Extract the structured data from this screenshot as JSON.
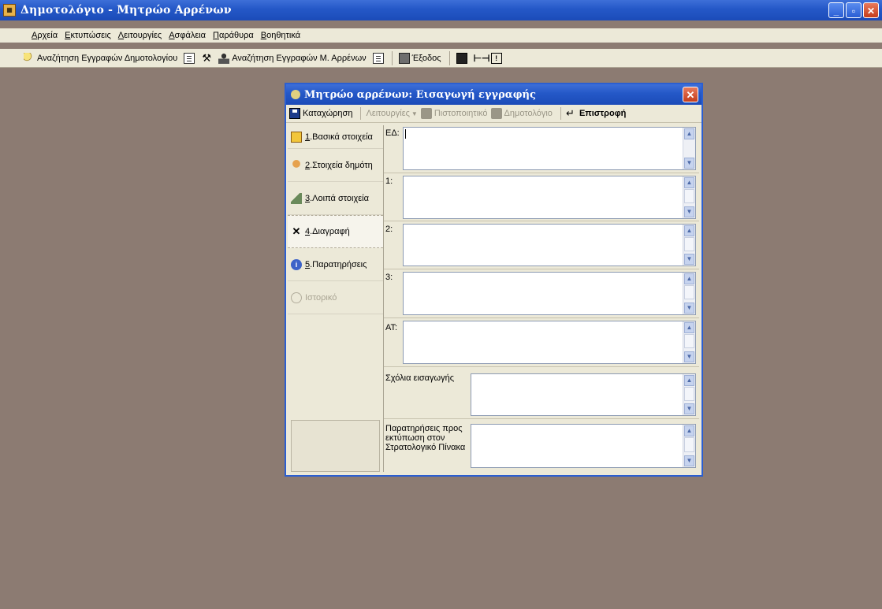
{
  "window": {
    "title": "Δημοτολόγιο - Μητρώο Αρρένων",
    "app_icon": "app-icon",
    "buttons": [
      "_",
      "▫",
      "✕"
    ]
  },
  "menu": [
    "Αρχεία",
    "Εκτυπώσεις",
    "Λειτουργίες",
    "Ασφάλεια",
    "Παράθυρα",
    "Βοηθητικά"
  ],
  "toolbar": {
    "search_dimotologio": "Αναζήτηση Εγγραφών Δημοτολογίου",
    "search_mitroo": "Αναζήτηση Εγγραφών Μ. Αρρένων",
    "exit": "Έξοδος"
  },
  "dialog": {
    "title": "Μητρώο αρρένων: Εισαγωγή εγγραφής",
    "close": "✕",
    "toolbar": {
      "save": "Καταχώρηση",
      "functions": "Λειτουργίες",
      "certificate": "Πιστοποιητικό",
      "dimotologio": "Δημοτολόγιο",
      "back": "Επιστροφή"
    },
    "tabs": [
      {
        "num": "1",
        "label": ".Βασικά στοιχεία"
      },
      {
        "num": "2",
        "label": ".Στοιχεία δημότη"
      },
      {
        "num": "3",
        "label": ".Λοιπά στοιχεία"
      },
      {
        "num": "4",
        "label": ".Διαγραφή"
      },
      {
        "num": "5",
        "label": ".Παρατηρήσεις"
      },
      {
        "num": "",
        "label": "Ιστορικό"
      }
    ],
    "fields": {
      "ed_label": "ΕΔ:",
      "f1_label": "1:",
      "f2_label": "2:",
      "f3_label": "3:",
      "at_label": "ΑΤ:",
      "comments_label": "Σχόλια εισαγωγής",
      "notes_label": "Παρατηρήσεις προς εκτύπωση στον Στρατολογικό Πίνακα"
    }
  },
  "colors": {
    "desktop": "#8c7b72",
    "titlebar": "#2458c7",
    "face": "#ece9d8"
  }
}
